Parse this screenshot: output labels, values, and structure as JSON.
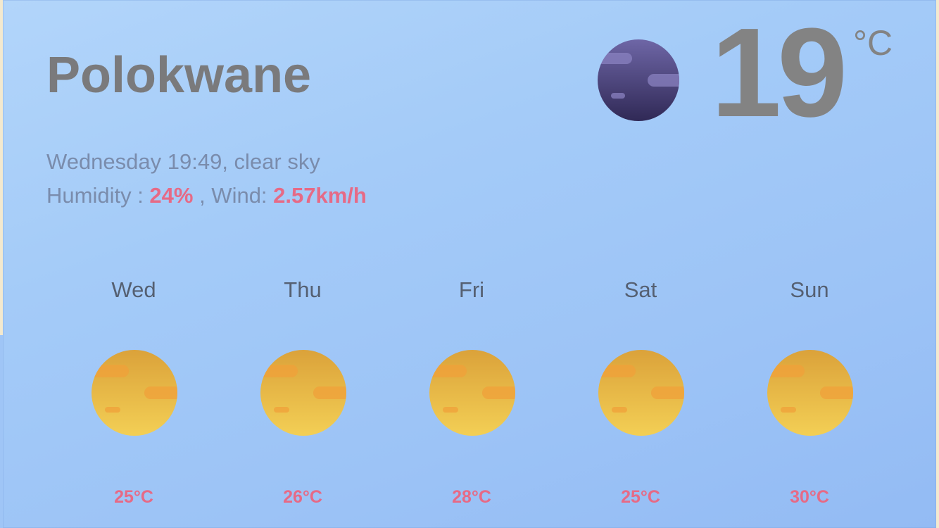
{
  "current": {
    "city": "Polokwane",
    "description_line": "Wednesday 19:49, clear sky",
    "humidity_label": "Humidity : ",
    "humidity_value": "24%",
    "wind_label": " , Wind: ",
    "wind_value": "2.57km/h",
    "temperature": "19",
    "unit": "°C",
    "icon": "moon-icon"
  },
  "forecast": [
    {
      "day": "Wed",
      "temp": "25°C",
      "icon": "sun-icon"
    },
    {
      "day": "Thu",
      "temp": "26°C",
      "icon": "sun-icon"
    },
    {
      "day": "Fri",
      "temp": "28°C",
      "icon": "sun-icon"
    },
    {
      "day": "Sat",
      "temp": "25°C",
      "icon": "sun-icon"
    },
    {
      "day": "Sun",
      "temp": "30°C",
      "icon": "sun-icon"
    }
  ],
  "colors": {
    "accent": "#e66a86",
    "title": "#7a7a7c",
    "background": "#a4cbf8",
    "sun": "#e9b73e",
    "moon": "#4d4580"
  }
}
